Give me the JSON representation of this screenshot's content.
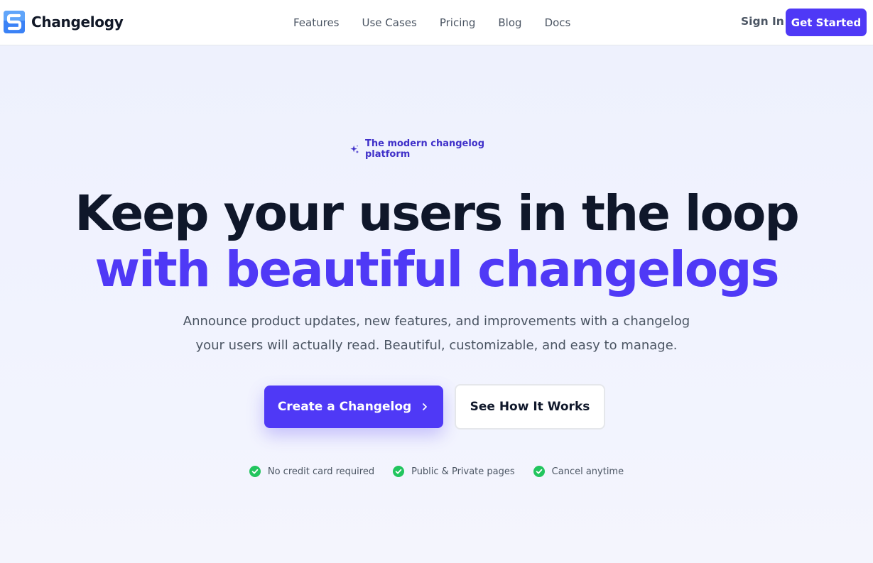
{
  "nav": {
    "brand_name": "Changelogy",
    "links": [
      "Features",
      "Use Cases",
      "Pricing",
      "Blog",
      "Docs"
    ],
    "sign_in_label": "Sign In",
    "get_started_label": "Get Started"
  },
  "hero": {
    "badge_text": "The modern changelog platform",
    "headline_line1": "Keep your users in the loop",
    "headline_line2": "with beautiful changelogs",
    "subtitle_line1": "Announce product updates, new features, and improvements with a changelog",
    "subtitle_line2": "your users will actually read. Beautiful, customizable, and easy to manage.",
    "primary_cta_label": "Create a Changelog",
    "secondary_cta_label": "See How It Works",
    "perks": [
      "No credit card required",
      "Public & Private pages",
      "Cancel anytime"
    ]
  },
  "colors": {
    "brand": "#4f39f6",
    "heading": "#0f172a",
    "body_text": "#4b5563",
    "check_green": "#22c55e",
    "background": "#eef1fd"
  },
  "icons": {
    "logo": "changelogy-logo-icon",
    "badge": "sparkles-icon",
    "cta": "chevron-right-icon",
    "perk": "check-circle-icon"
  }
}
